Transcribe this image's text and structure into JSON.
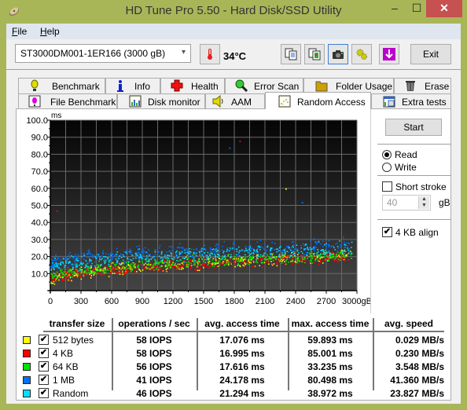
{
  "window": {
    "title": "HD Tune Pro 5.50 - Hard Disk/SSD Utility",
    "minimize": "–",
    "maximize": "☐",
    "close": "✕"
  },
  "menu": [
    {
      "label": "File",
      "mnemonic": "F",
      "rest": "ile"
    },
    {
      "label": "Help",
      "mnemonic": "H",
      "rest": "elp"
    }
  ],
  "toolbar": {
    "drive": "ST3000DM001-1ER166 (3000 gB)",
    "temperature": "34°C",
    "buttons": [
      "copy-text-icon",
      "copy-image-icon",
      "screenshot-camera-icon",
      "options-gear-icon",
      "save-download-icon"
    ],
    "exit_label": "Exit"
  },
  "tabs_row1": [
    {
      "label": "Benchmark",
      "icon": "benchmark-icon"
    },
    {
      "label": "Info",
      "icon": "info-icon"
    },
    {
      "label": "Health",
      "icon": "health-icon"
    },
    {
      "label": "Error Scan",
      "icon": "error-scan-icon"
    },
    {
      "label": "Folder Usage",
      "icon": "folder-icon"
    },
    {
      "label": "Erase",
      "icon": "trash-icon"
    }
  ],
  "tabs_row2": [
    {
      "label": "File Benchmark",
      "icon": "file-benchmark-icon"
    },
    {
      "label": "Disk monitor",
      "icon": "disk-monitor-icon"
    },
    {
      "label": "AAM",
      "icon": "speaker-icon"
    },
    {
      "label": "Random Access",
      "icon": "random-access-icon",
      "active": true
    },
    {
      "label": "Extra tests",
      "icon": "extra-tests-icon"
    }
  ],
  "side": {
    "start_label": "Start",
    "read_label": "Read",
    "write_label": "Write",
    "mode": "Read",
    "short_stroke_label": "Short stroke",
    "short_stroke_checked": false,
    "short_stroke_value": "40",
    "short_stroke_unit": "gB",
    "align_label": "4 KB align",
    "align_checked": true
  },
  "chart_data": {
    "type": "scatter",
    "title": "",
    "ylabel": "ms",
    "xlabel": "gB",
    "xlim": [
      0,
      3000
    ],
    "ylim": [
      0,
      100
    ],
    "x_ticks": [
      "0",
      "300",
      "600",
      "900",
      "1200",
      "1500",
      "1800",
      "2100",
      "2400",
      "2700",
      "3000gB"
    ],
    "y_ticks": [
      "100.0",
      "90.0",
      "80.0",
      "70.0",
      "60.0",
      "50.0",
      "40.0",
      "30.0",
      "20.0",
      "10.0"
    ],
    "grid": true,
    "series": [
      {
        "name": "512 bytes",
        "color": "#ffff00",
        "trend": {
          "start_ms": 6,
          "end_ms": 21,
          "spread_ms": 5
        }
      },
      {
        "name": "4 KB",
        "color": "#ff0000",
        "trend": {
          "start_ms": 6,
          "end_ms": 20,
          "spread_ms": 5
        }
      },
      {
        "name": "64 KB",
        "color": "#00e000",
        "trend": {
          "start_ms": 8,
          "end_ms": 21,
          "spread_ms": 5
        }
      },
      {
        "name": "1 MB",
        "color": "#0070ff",
        "trend": {
          "start_ms": 16,
          "end_ms": 27,
          "spread_ms": 6
        }
      },
      {
        "name": "Random",
        "color": "#00e0ff",
        "trend": {
          "start_ms": 13,
          "end_ms": 25,
          "spread_ms": 6
        }
      }
    ],
    "outliers": [
      {
        "x": 60,
        "y": 47,
        "series": "4 KB"
      },
      {
        "x": 1750,
        "y": 84,
        "series": "1 MB"
      },
      {
        "x": 1850,
        "y": 88,
        "series": "4 KB"
      },
      {
        "x": 2300,
        "y": 60,
        "series": "512 bytes"
      },
      {
        "x": 2460,
        "y": 52,
        "series": "1 MB"
      }
    ]
  },
  "table": {
    "headers": [
      "transfer size",
      "operations / sec",
      "avg. access time",
      "max. access time",
      "avg. speed"
    ],
    "rows": [
      {
        "color": "#ffff00",
        "checked": true,
        "name": "512 bytes",
        "ops": "58 IOPS",
        "avg": "17.076 ms",
        "max": "59.893 ms",
        "speed": "0.029 MB/s"
      },
      {
        "color": "#ff0000",
        "checked": true,
        "name": "4 KB",
        "ops": "58 IOPS",
        "avg": "16.995 ms",
        "max": "85.001 ms",
        "speed": "0.230 MB/s"
      },
      {
        "color": "#00e000",
        "checked": true,
        "name": "64 KB",
        "ops": "56 IOPS",
        "avg": "17.616 ms",
        "max": "33.235 ms",
        "speed": "3.548 MB/s"
      },
      {
        "color": "#0070ff",
        "checked": true,
        "name": "1 MB",
        "ops": "41 IOPS",
        "avg": "24.178 ms",
        "max": "80.498 ms",
        "speed": "41.360 MB/s"
      },
      {
        "color": "#00e0ff",
        "checked": true,
        "name": "Random",
        "ops": "46 IOPS",
        "avg": "21.294 ms",
        "max": "38.972 ms",
        "speed": "23.827 MB/s"
      }
    ]
  }
}
